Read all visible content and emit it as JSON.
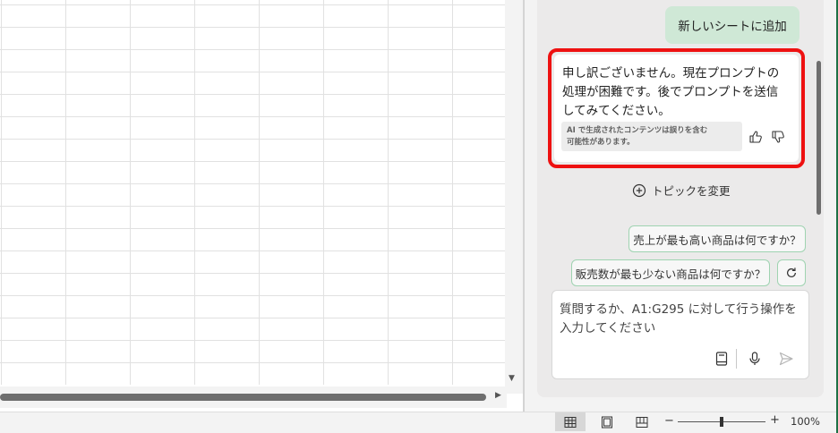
{
  "chat": {
    "user_message": "新しいシートに追加",
    "ai_response_lines": [
      "申し訳ございません。現在プロンプトの",
      "処理が困難です。後でプロンプトを送信",
      "してみてください。"
    ],
    "ai_disclaimer_lines": [
      "AI で生成されたコンテンツは誤りを含む",
      "可能性があります。"
    ],
    "change_topic_label": "トピックを変更",
    "suggestions": [
      "売上が最も高い商品は何ですか？",
      "販売数が最も少ない商品は何ですか？"
    ],
    "input_placeholder_lines": [
      "質問するか、A1:G295 に対して行う操作を",
      "入力してください"
    ]
  },
  "statusbar": {
    "zoom_minus": "−",
    "zoom_plus": "+",
    "zoom_percent": "100%",
    "zoom_level": 1.0
  },
  "colors": {
    "highlight_frame": "#ee1111",
    "user_bubble": "#cfe8d6",
    "chip_border": "#9fd3b1",
    "excel_green": "#1e7145"
  }
}
